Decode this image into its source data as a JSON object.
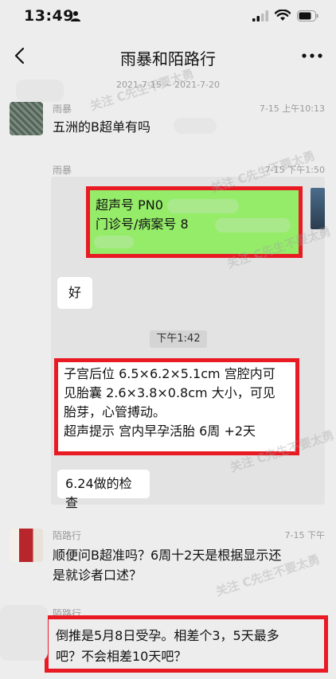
{
  "status_bar": {
    "time": "13:49"
  },
  "header": {
    "title": "雨暴和陌路行"
  },
  "date_range": "2021-7-15 ~ 2021-7-20",
  "watermark": "关注 C先生不要太勇",
  "messages": [
    {
      "sender": "雨暴",
      "time": "7-15 上午10:13",
      "text": "五洲的B超单有吗"
    },
    {
      "sender": "雨暴",
      "time": "7-15 下午1:50",
      "image": {
        "line1_prefix": "超声号 PN0",
        "line2_prefix": "门诊号/病案号 8"
      }
    },
    {
      "text": "好"
    },
    {
      "time_divider": "下午1:42"
    },
    {
      "lines": [
        "子宫后位 6.5×6.2×5.1cm 宫腔内可",
        "见胎囊 2.6×3.8×0.8cm 大小，可见",
        "胎芽，心管搏动。",
        "超声提示 宫内早孕活胎 6周 +2天"
      ]
    },
    {
      "text": "6.24做的检查"
    },
    {
      "sender": "陌路行",
      "time": "7-15 下午",
      "lines": [
        "顺便问B超准吗？6周十2天是根据显示还",
        "是就诊者口述？"
      ]
    },
    {
      "sender": "陌路行",
      "lines": [
        "倒推是5月8日受孕。相差个3，5天最多",
        "吧？不会相差10天吧？"
      ]
    }
  ]
}
